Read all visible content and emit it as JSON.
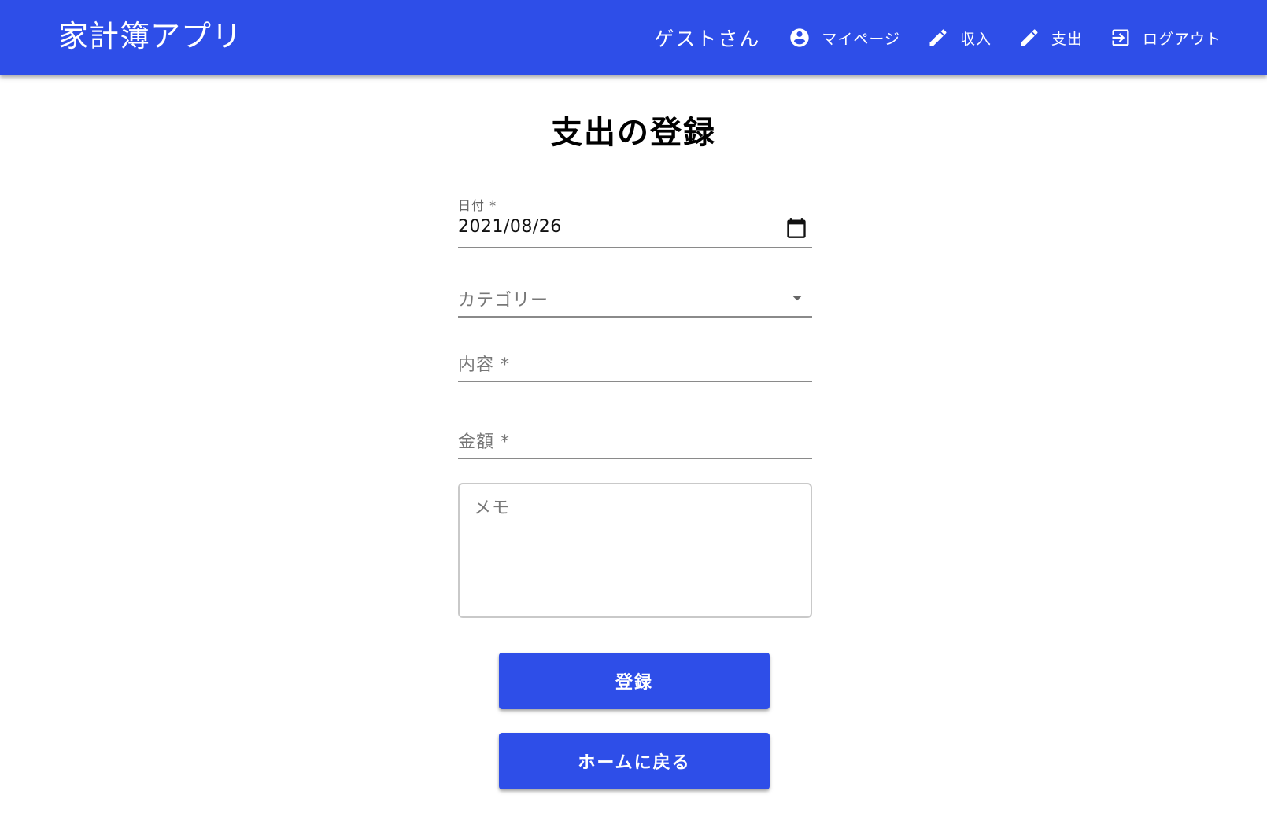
{
  "header": {
    "app_title": "家計簿アプリ",
    "user_greeting": "ゲストさん",
    "nav": [
      {
        "label": "マイページ",
        "icon": "account-circle-icon"
      },
      {
        "label": "収入",
        "icon": "pencil-icon"
      },
      {
        "label": "支出",
        "icon": "pencil-icon"
      },
      {
        "label": "ログアウト",
        "icon": "logout-icon"
      }
    ]
  },
  "page": {
    "title": "支出の登録"
  },
  "form": {
    "date": {
      "label": "日付 *",
      "value": "2021/08/26"
    },
    "category": {
      "placeholder": "カテゴリー"
    },
    "content": {
      "placeholder": "内容 *"
    },
    "amount": {
      "placeholder": "金額 *"
    },
    "memo": {
      "placeholder": "メモ"
    }
  },
  "buttons": {
    "submit": "登録",
    "back_home": "ホームに戻る"
  },
  "colors": {
    "primary": "#2e4ee8",
    "underline": "#8a8a8a"
  }
}
